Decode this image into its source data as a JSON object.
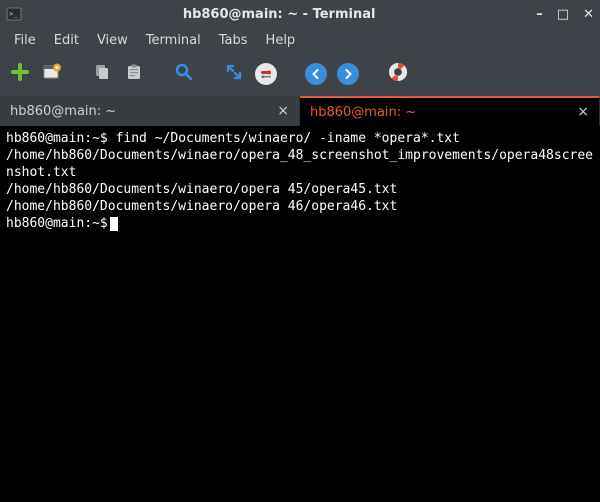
{
  "window": {
    "title": "hb860@main: ~ - Terminal"
  },
  "menu": {
    "items": [
      "File",
      "Edit",
      "View",
      "Terminal",
      "Tabs",
      "Help"
    ]
  },
  "toolbar": {
    "icons": [
      "new-tab-icon",
      "new-window-icon",
      "copy-icon",
      "paste-icon",
      "search-icon",
      "fullscreen-icon",
      "preferences-icon",
      "back-icon",
      "forward-icon",
      "help-icon"
    ]
  },
  "tabs": [
    {
      "label": "hb860@main: ~",
      "active": false
    },
    {
      "label": "hb860@main: ~",
      "active": true
    }
  ],
  "terminal": {
    "prompt1": "hb860@main:~$ ",
    "command": "find ~/Documents/winaero/ -iname *opera*.txt",
    "output_lines": [
      "/home/hb860/Documents/winaero/opera_48_screenshot_improvements/opera48screenshot.txt",
      "/home/hb860/Documents/winaero/opera 45/opera45.txt",
      "/home/hb860/Documents/winaero/opera 46/opera46.txt"
    ],
    "prompt2": "hb860@main:~$"
  }
}
